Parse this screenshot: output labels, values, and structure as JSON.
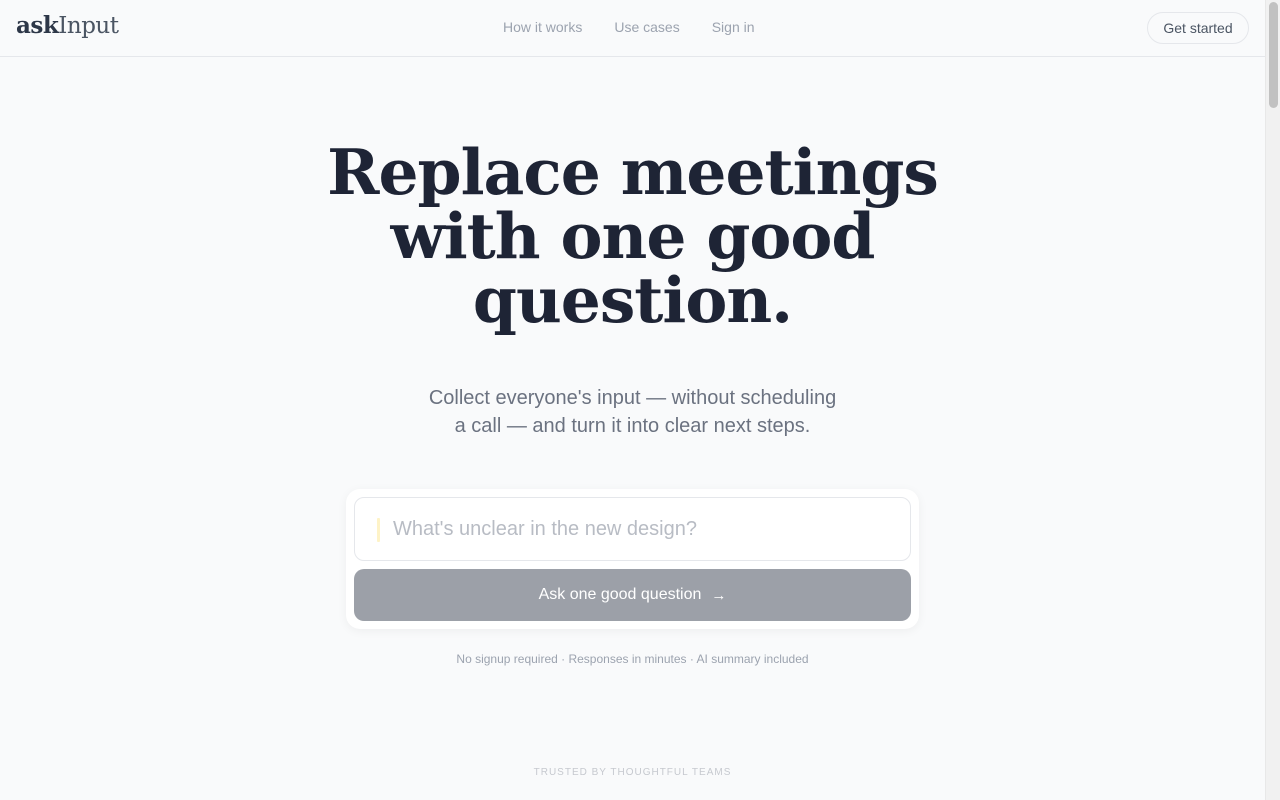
{
  "header": {
    "logo_ask": "ask",
    "logo_input": "Input",
    "nav": [
      "How it works",
      "Use cases",
      "Sign in"
    ],
    "cta_label": "Get started"
  },
  "hero": {
    "headline_lines": [
      "Replace meetings",
      "with one good",
      "question."
    ],
    "subheadline_lines": [
      "Collect everyone's input — without scheduling",
      "a call — and turn it into clear next steps."
    ]
  },
  "question_form": {
    "placeholder": "What's unclear in the new design?",
    "value": "",
    "submit_label": "Ask one good question",
    "submit_icon": "arrow-right-icon",
    "caret_color": "#fef3c7"
  },
  "note": "No signup required · Responses in minutes · AI summary included",
  "trusted_label": "TRUSTED BY THOUGHTFUL TEAMS",
  "colors": {
    "background": "#f9fafb",
    "headline": "#1e2435",
    "button_disabled": "#9ca0a8"
  }
}
